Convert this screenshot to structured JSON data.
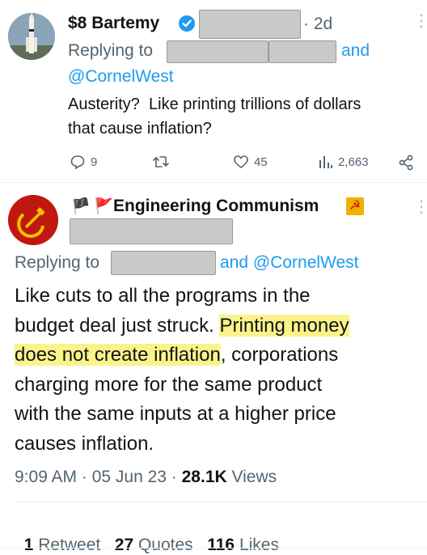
{
  "reply_tweet": {
    "display_name": "$8 Bartemy",
    "time_ago": "2d",
    "replying_to_label": "Replying to",
    "replying_and": "and",
    "replying_mention": "@CornelWest",
    "text_line1": "Austerity?  Like printing trillions of dollars",
    "text_line2": "that cause inflation?",
    "actions": {
      "replies": "9",
      "retweets": "",
      "likes": "45",
      "views": "2,663"
    }
  },
  "main_tweet": {
    "flags": "🏴 🚩",
    "display_name": "Engineering Communism",
    "badge": "☭",
    "replying_to_label": "Replying to",
    "replying_and_mention": "and @CornelWest",
    "text": {
      "line1": "Like cuts to all the programs in the",
      "line2_prefix": "budget deal just struck. ",
      "line2_highlight": "Printing money",
      "line3_highlight": "does not create inflation",
      "line3_suffix": ", corporations",
      "line4": "charging more for the same product",
      "line5": "with the same inputs at a higher price",
      "line6": "causes inflation."
    },
    "timestamp": "9:09 AM · 05 Jun 23 · ",
    "views_count": "28.1K",
    "views_label": " Views",
    "stats": {
      "retweets": "1",
      "retweets_label": "Retweet",
      "quotes": "27",
      "quotes_label": "Quotes",
      "likes": "116",
      "likes_label": "Likes"
    }
  },
  "colors": {
    "link": "#1d9bf0",
    "verified": "#1d9bf0",
    "highlight": "#fbf38a",
    "avatar_red": "#c0170f"
  }
}
